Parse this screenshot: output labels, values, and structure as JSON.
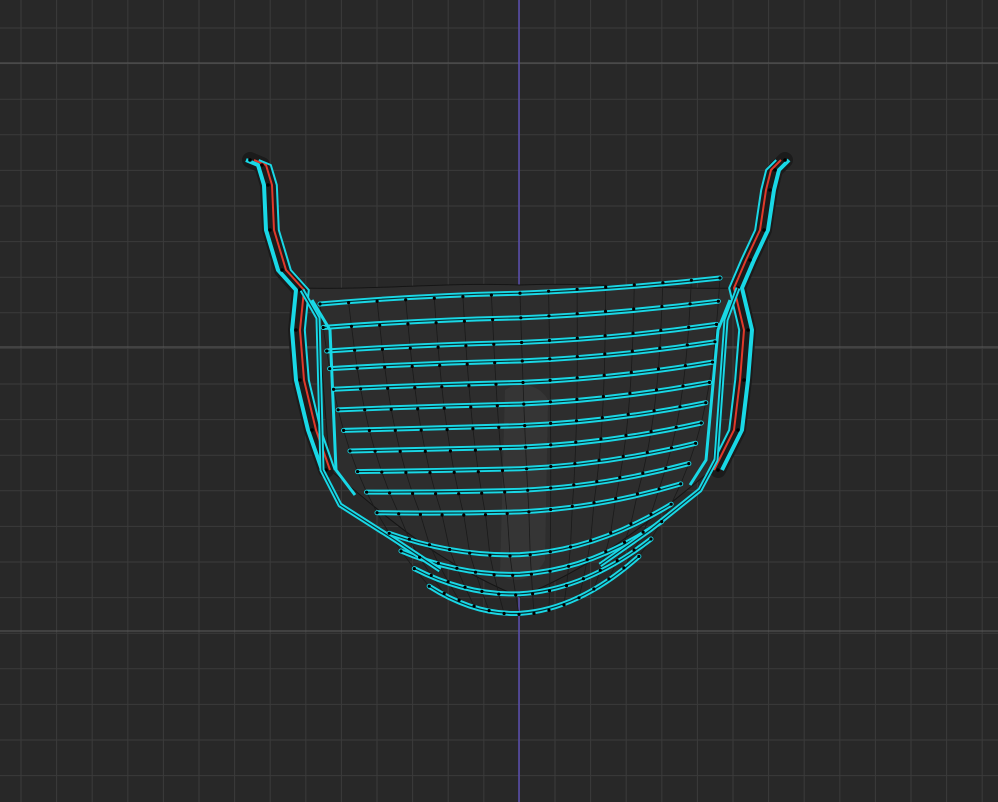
{
  "viewport": {
    "view": "front",
    "object": "face-mask",
    "mode": "edit",
    "grid": true,
    "symmetry_axis": "x"
  },
  "colors": {
    "background": "#282828",
    "grid_minor": "#3b3b3b",
    "grid_major": "#5a5a5a",
    "axis": "#5b4fb0",
    "selected_edge": "#19d8e6",
    "selected_edge_inner": "#0b2f33",
    "seam_edge": "#e0392a",
    "mesh_fill": "#2d2d2d",
    "mesh_shade": "#3a3a3a",
    "vertex": "#000000"
  }
}
